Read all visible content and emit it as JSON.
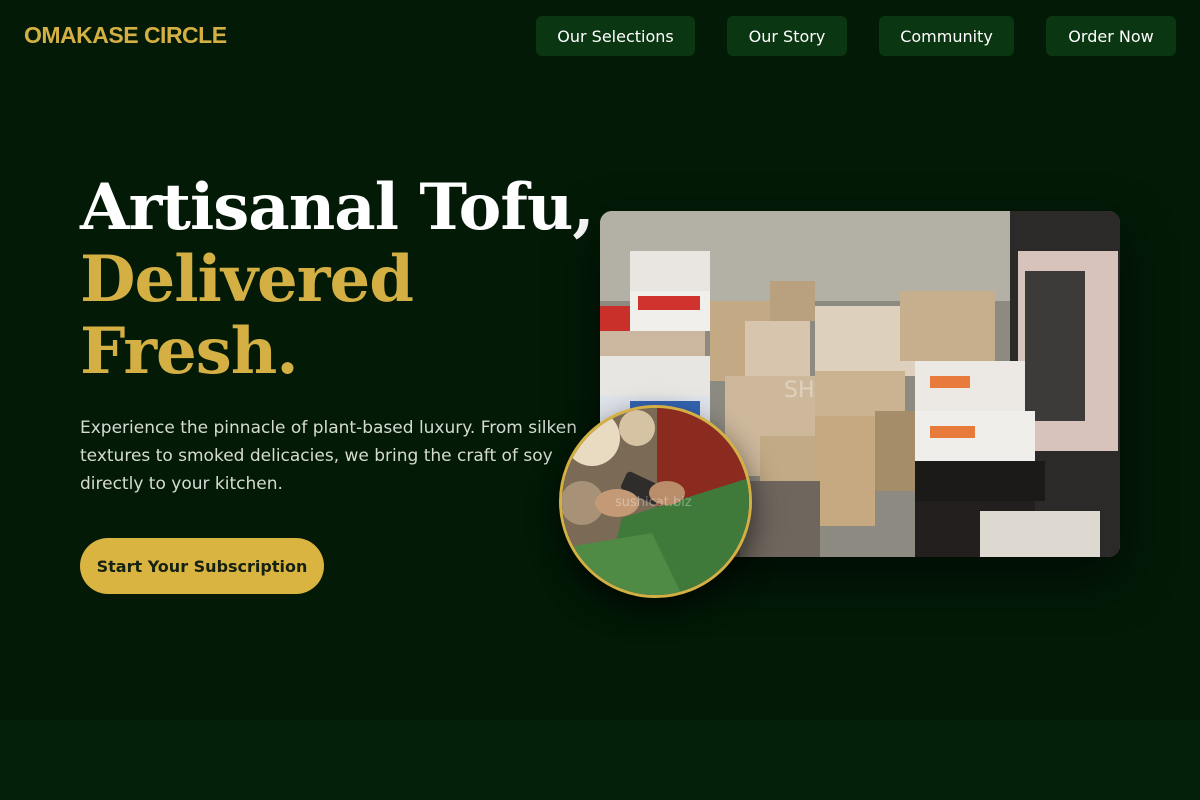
{
  "nav": {
    "brand": "OMAKASE CIRCLE",
    "links": [
      "Our Selections",
      "Our Story",
      "Community",
      "Order Now"
    ]
  },
  "hero": {
    "headline_line1": "Artisanal Tofu,",
    "headline_line2": "Delivered",
    "headline_line3": "Fresh.",
    "description": "Experience the pinnacle of plant-based luxury. From silken textures to smoked delicacies, we bring the craft of soy directly to your kitchen.",
    "cta_label": "Start Your Subscription"
  },
  "media": {
    "main_image_watermark": "SH",
    "inset_image_caption": "sushicat.biz"
  },
  "colors": {
    "background": "#031a07",
    "accent_gold": "#d4b044",
    "nav_button": "#0b3612",
    "cta": "#d9b441"
  }
}
